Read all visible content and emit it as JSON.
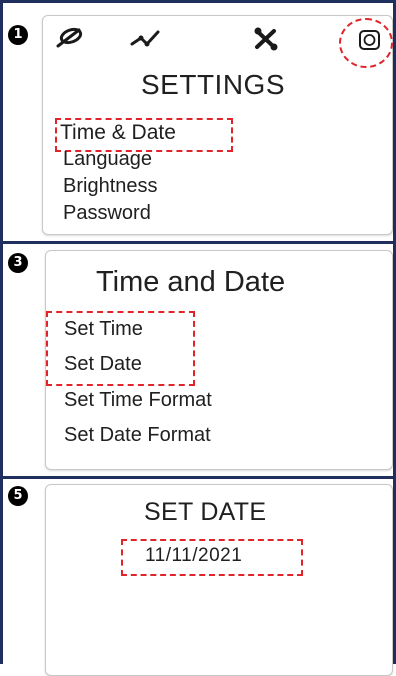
{
  "panel1": {
    "step": "1",
    "title": "SETTINGS",
    "icons": [
      "leaf-icon",
      "chart-line-icon",
      "tools-icon",
      "gear-icon"
    ],
    "menu": [
      "Time & Date",
      "Language",
      "Brightness",
      "Password"
    ]
  },
  "panel3": {
    "step": "3",
    "title": "Time and Date",
    "menu": [
      "Set Time",
      "Set Date",
      "Set Time Format",
      "Set Date Format"
    ]
  },
  "panel5": {
    "step": "5",
    "title": "SET DATE",
    "date_value": "11/11/2021"
  },
  "colors": {
    "frame": "#1f2f5e",
    "highlight": "#e0242a"
  }
}
